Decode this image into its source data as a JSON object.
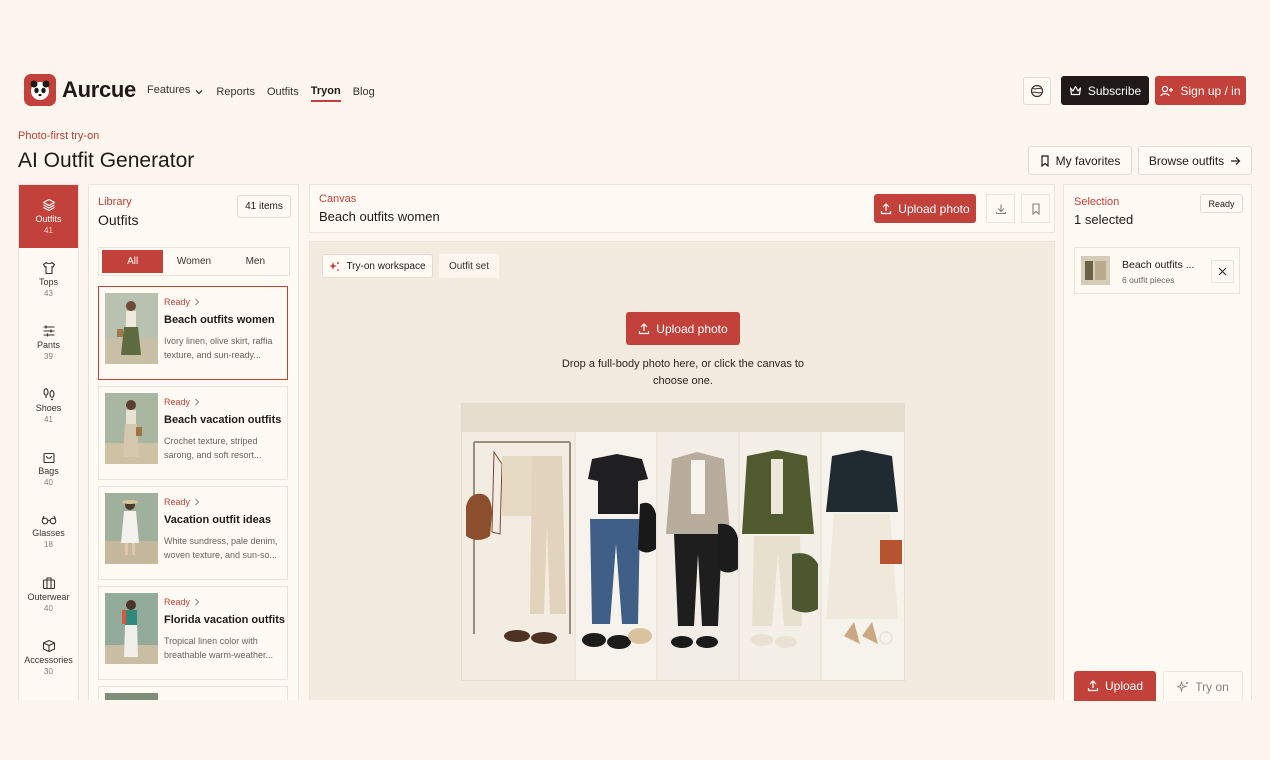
{
  "brand": {
    "name": "Aurcue"
  },
  "nav": {
    "features": "Features",
    "reports": "Reports",
    "outfits": "Outfits",
    "tryon": "Tryon",
    "blog": "Blog"
  },
  "header": {
    "subscribe": "Subscribe",
    "signup": "Sign up / in"
  },
  "page": {
    "eyebrow": "Photo-first try-on",
    "title": "AI Outfit Generator",
    "favorites": "My favorites",
    "browse": "Browse outfits"
  },
  "categories": [
    {
      "label": "Outfits",
      "count": "41",
      "icon": "layers-icon",
      "active": true
    },
    {
      "label": "Tops",
      "count": "43",
      "icon": "shirt-icon"
    },
    {
      "label": "Pants",
      "count": "39",
      "icon": "sliders-icon"
    },
    {
      "label": "Shoes",
      "count": "41",
      "icon": "footprints-icon"
    },
    {
      "label": "Bags",
      "count": "40",
      "icon": "bag-icon"
    },
    {
      "label": "Glasses",
      "count": "18",
      "icon": "glasses-icon"
    },
    {
      "label": "Outerwear",
      "count": "40",
      "icon": "briefcase-icon"
    },
    {
      "label": "Accessories",
      "count": "30",
      "icon": "box-icon"
    }
  ],
  "library": {
    "eyebrow": "Library",
    "title": "Outfits",
    "count": "41 items",
    "tabs": [
      "All",
      "Women",
      "Men"
    ],
    "items": [
      {
        "status": "Ready",
        "title": "Beach outfits women",
        "desc": "Ivory linen, olive skirt, raffia texture, and sun-ready..."
      },
      {
        "status": "Ready",
        "title": "Beach vacation outfits",
        "desc": "Crochet texture, striped sarong, and soft resort..."
      },
      {
        "status": "Ready",
        "title": "Vacation outfit ideas",
        "desc": "White sundress, pale denim, woven texture, and sun-so..."
      },
      {
        "status": "Ready",
        "title": "Florida vacation outfits",
        "desc": "Tropical linen color with breathable warm-weather..."
      }
    ]
  },
  "canvas": {
    "eyebrow": "Canvas",
    "title": "Beach outfits women",
    "upload": "Upload photo",
    "tab_workspace": "Try-on workspace",
    "tab_set": "Outfit set",
    "drop_upload": "Upload photo",
    "drop_hint": "Drop a full-body photo here, or click the canvas to choose one."
  },
  "selection": {
    "eyebrow": "Selection",
    "title": "1 selected",
    "badge": "Ready",
    "item_title": "Beach outfits ...",
    "item_sub": "6 outfit pieces",
    "upload": "Upload",
    "tryon": "Try on"
  },
  "colors": {
    "accent": "#c2413a",
    "dark": "#1f1a17",
    "background": "#fcf6ee"
  }
}
